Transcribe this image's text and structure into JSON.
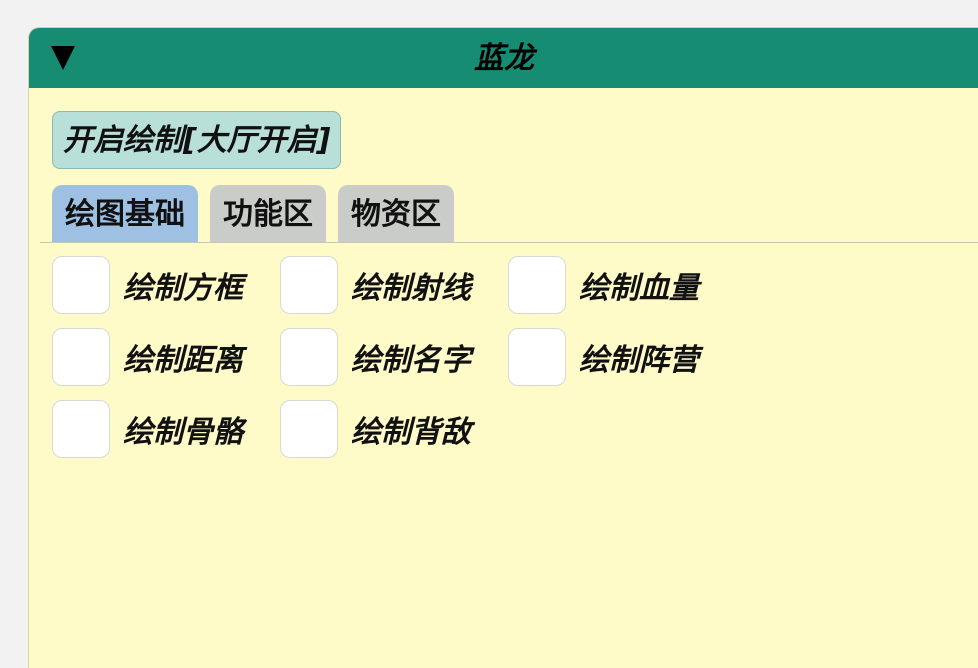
{
  "window": {
    "title": "蓝龙"
  },
  "toolbar": {
    "draw_toggle_label": "开启绘制[大厅开启]"
  },
  "tabs": [
    {
      "label": "绘图基础",
      "active": true
    },
    {
      "label": "功能区",
      "active": false
    },
    {
      "label": "物资区",
      "active": false
    }
  ],
  "options": [
    {
      "label": "绘制方框",
      "checked": false
    },
    {
      "label": "绘制射线",
      "checked": false
    },
    {
      "label": "绘制血量",
      "checked": false
    },
    {
      "label": "绘制距离",
      "checked": false
    },
    {
      "label": "绘制名字",
      "checked": false
    },
    {
      "label": "绘制阵营",
      "checked": false
    },
    {
      "label": "绘制骨骼",
      "checked": false
    },
    {
      "label": "绘制背敌",
      "checked": false
    }
  ],
  "colors": {
    "titlebar": "#168c72",
    "panel_background": "#fefbc8",
    "active_tab": "#9dc0e3",
    "inactive_tab": "#c9ccc9",
    "toggle_button": "#b9e0d8"
  }
}
